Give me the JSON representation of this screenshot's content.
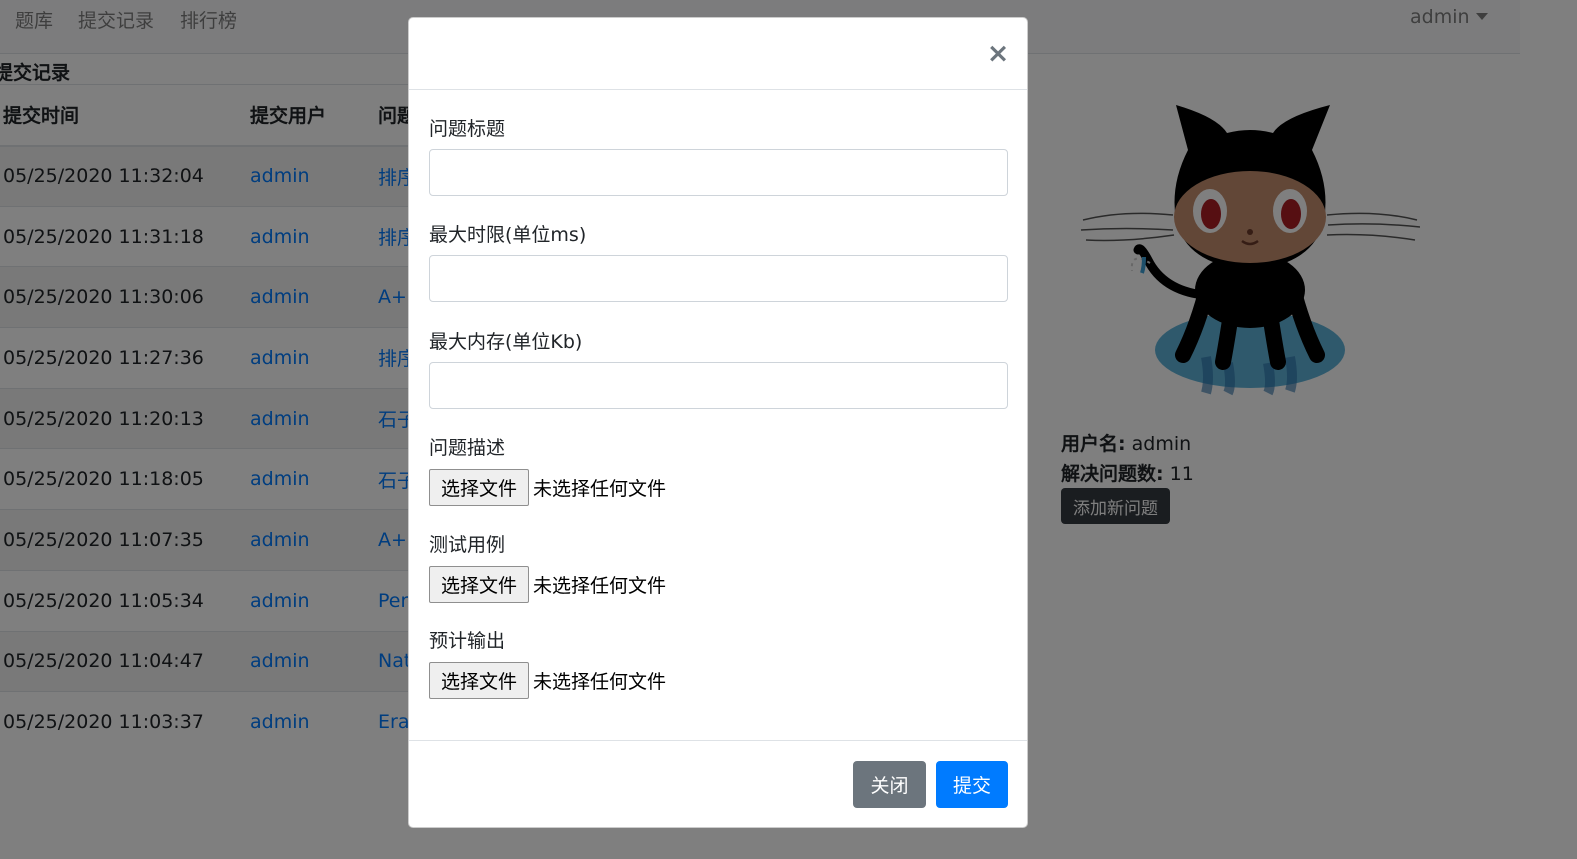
{
  "navbar": {
    "links": [
      "题库",
      "提交记录",
      "排行榜"
    ],
    "user": "admin"
  },
  "section_title": "提交记录",
  "submissions": {
    "headers": [
      "提交时间",
      "提交用户",
      "问题"
    ],
    "rows": [
      {
        "time": "05/25/2020 11:32:04",
        "user": "admin",
        "problem": "排序"
      },
      {
        "time": "05/25/2020 11:31:18",
        "user": "admin",
        "problem": "排序"
      },
      {
        "time": "05/25/2020 11:30:06",
        "user": "admin",
        "problem": "A+B"
      },
      {
        "time": "05/25/2020 11:27:36",
        "user": "admin",
        "problem": "排序"
      },
      {
        "time": "05/25/2020 11:20:13",
        "user": "admin",
        "problem": "石子"
      },
      {
        "time": "05/25/2020 11:18:05",
        "user": "admin",
        "problem": "石子"
      },
      {
        "time": "05/25/2020 11:07:35",
        "user": "admin",
        "problem": "A+B"
      },
      {
        "time": "05/25/2020 11:05:34",
        "user": "admin",
        "problem": "Perf"
      },
      {
        "time": "05/25/2020 11:04:47",
        "user": "admin",
        "problem": "Nat"
      },
      {
        "time": "05/25/2020 11:03:37",
        "user": "admin",
        "problem": "Eras"
      }
    ]
  },
  "profile": {
    "username_label": "用户名:",
    "username": "admin",
    "solved_label": "解决问题数:",
    "solved": "11",
    "add_button": "添加新问题",
    "avatar_icon": "octocat-icon"
  },
  "modal": {
    "close_symbol": "×",
    "title_label": "问题标题",
    "time_label": "最大时限(单位ms)",
    "memory_label": "最大内存(单位Kb)",
    "desc_label": "问题描述",
    "test_label": "测试用例",
    "output_label": "预计输出",
    "file_button": "选择文件",
    "file_status": "未选择任何文件",
    "close_button": "关闭",
    "submit_button": "提交"
  },
  "colors": {
    "primary": "#007bff",
    "secondary": "#6c757d",
    "dark": "#343a40"
  }
}
